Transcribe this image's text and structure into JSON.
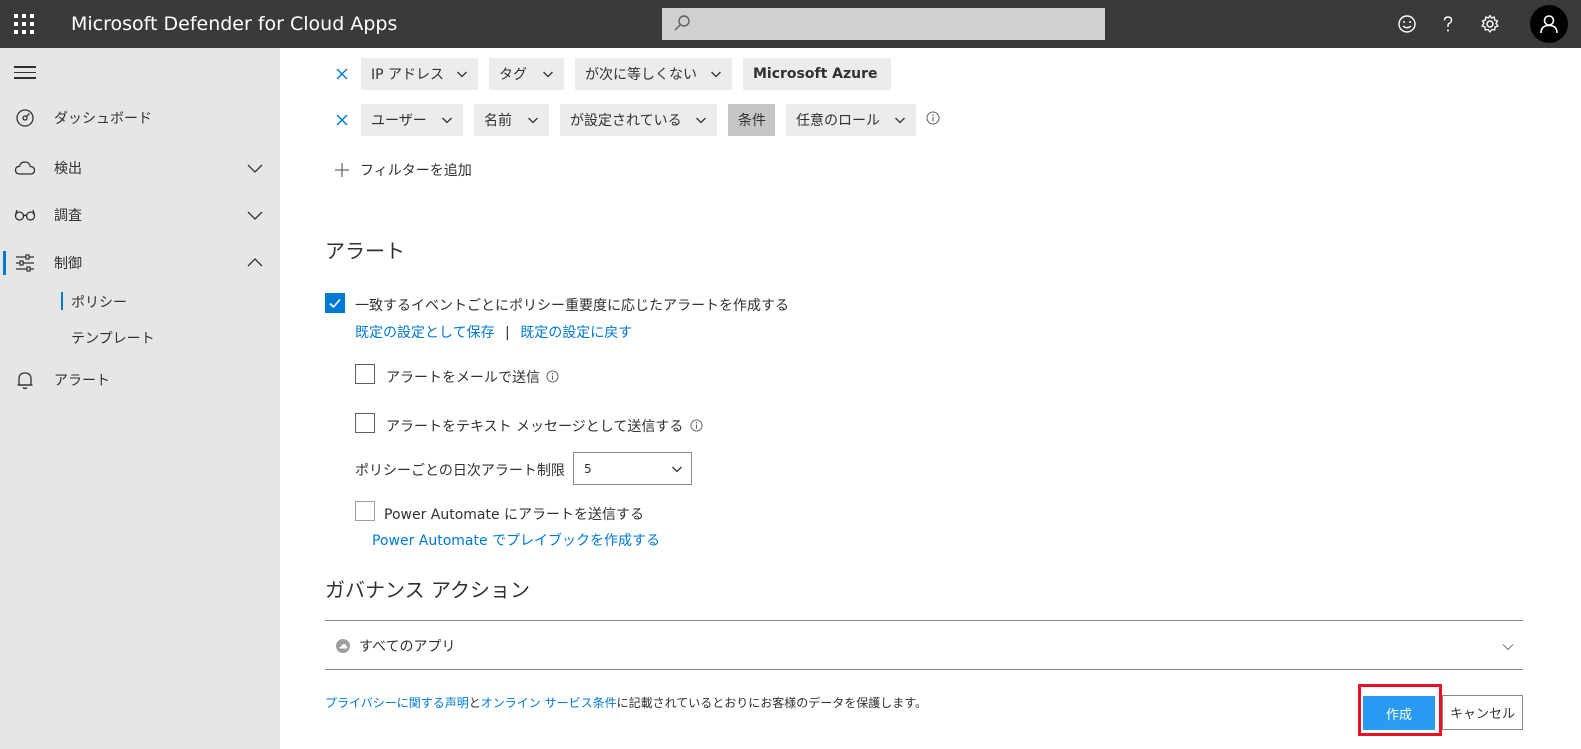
{
  "header": {
    "app_title": "Microsoft Defender for Cloud Apps",
    "search_placeholder": "",
    "icons": [
      "waffle-icon",
      "search-icon",
      "feedback-icon",
      "help-icon",
      "settings-icon",
      "avatar-icon"
    ]
  },
  "sidebar": {
    "items": [
      {
        "label": "ダッシュボード",
        "icon": "dashboard-icon"
      },
      {
        "label": "検出",
        "icon": "cloud-icon"
      },
      {
        "label": "調査",
        "icon": "glasses-icon"
      },
      {
        "label": "制御",
        "icon": "sliders-icon"
      },
      {
        "label": "アラート",
        "icon": "bell-icon"
      }
    ],
    "sub_items": [
      {
        "label": "ポリシー"
      },
      {
        "label": "テンプレート"
      }
    ]
  },
  "filters": {
    "row1": {
      "field": "IP アドレス",
      "attribute": "タグ",
      "operator": "が次に等しくない",
      "value": "Microsoft Azure"
    },
    "row2": {
      "field": "ユーザー",
      "attribute": "名前",
      "operator": "が設定されている",
      "condition": "条件",
      "value": "任意のロール"
    },
    "add_filter": "フィルターを追加"
  },
  "alerts": {
    "title": "アラート",
    "create_alert": "一致するイベントごとにポリシー重要度に応じたアラートを作成する",
    "save_default": "既定の設定として保存",
    "separator": "|",
    "restore_default": "既定の設定に戻す",
    "email": "アラートをメールで送信",
    "sms": "アラートをテキスト メッセージとして送信する",
    "daily_limit_label": "ポリシーごとの日次アラート制限",
    "daily_limit_value": "5",
    "power_automate": "Power Automate にアラートを送信する",
    "power_automate_link": "Power Automate でプレイブックを作成する"
  },
  "governance": {
    "title": "ガバナンス アクション",
    "all_apps": "すべてのアプリ"
  },
  "footer": {
    "privacy_link": "プライバシーに関する声明",
    "and": "と",
    "terms_link": "オンライン サービス条件",
    "tail": "に記載されているとおりにお客様のデータを保護します。"
  },
  "buttons": {
    "create": "作成",
    "cancel": "キャンセル"
  },
  "colors": {
    "topbar": "#3b3a39",
    "sidebar": "#e6e6e6",
    "accent": "#0078d4",
    "primary_button": "#2b9af3",
    "highlight_outline": "#e81123"
  }
}
